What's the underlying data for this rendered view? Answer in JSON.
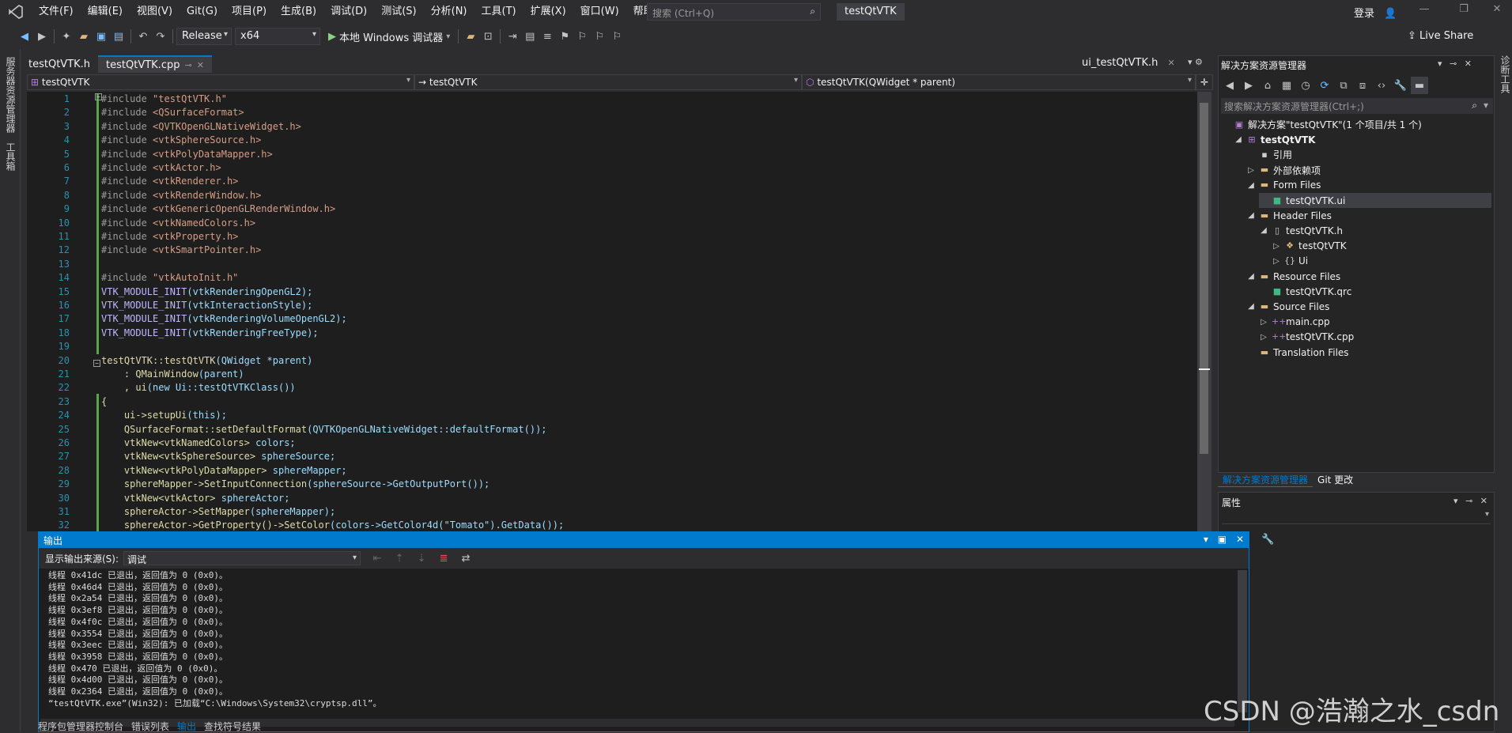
{
  "menubar": {
    "items": [
      "文件(F)",
      "编辑(E)",
      "视图(V)",
      "Git(G)",
      "项目(P)",
      "生成(B)",
      "调试(D)",
      "测试(S)",
      "分析(N)",
      "工具(T)",
      "扩展(X)",
      "窗口(W)",
      "帮助(H)"
    ],
    "search_placeholder": "搜索 (Ctrl+Q)",
    "app_name": "testQtVTK",
    "login": "登录"
  },
  "toolbar": {
    "config": "Release",
    "platform": "x64",
    "run_label": "本地 Windows 调试器",
    "live_share": "Live Share"
  },
  "left_strip": [
    "服务器资源管理器",
    "工具箱"
  ],
  "doc_tabs": [
    {
      "label": "testQtVTK.h",
      "active": false
    },
    {
      "label": "testQtVTK.cpp",
      "active": true,
      "pin": "⊸"
    }
  ],
  "doc_tab_right": "ui_testQtVTK.h",
  "navbar": {
    "project": "testQtVTK",
    "scope": "testQtVTK",
    "member": "testQtVTK(QWidget * parent)"
  },
  "editor": {
    "line_numbers": [
      "1",
      "2",
      "3",
      "4",
      "5",
      "6",
      "7",
      "8",
      "9",
      "10",
      "11",
      "12",
      "13",
      "14",
      "15",
      "16",
      "17",
      "18",
      "19",
      "20",
      "21",
      "22",
      "23",
      "24",
      "25",
      "26",
      "27",
      "28",
      "29",
      "30",
      "31",
      "32"
    ],
    "lines": [
      {
        "t": "pp",
        "s": "#include ",
        "b": "\"testQtVTK.h\""
      },
      {
        "t": "pp",
        "s": "#include ",
        "b": "<QSurfaceFormat>"
      },
      {
        "t": "pp",
        "s": "#include ",
        "b": "<QVTKOpenGLNativeWidget.h>"
      },
      {
        "t": "pp",
        "s": "#include ",
        "b": "<vtkSphereSource.h>"
      },
      {
        "t": "pp",
        "s": "#include ",
        "b": "<vtkPolyDataMapper.h>"
      },
      {
        "t": "pp",
        "s": "#include ",
        "b": "<vtkActor.h>"
      },
      {
        "t": "pp",
        "s": "#include ",
        "b": "<vtkRenderer.h>"
      },
      {
        "t": "pp",
        "s": "#include ",
        "b": "<vtkRenderWindow.h>"
      },
      {
        "t": "pp",
        "s": "#include ",
        "b": "<vtkGenericOpenGLRenderWindow.h>"
      },
      {
        "t": "pp",
        "s": "#include ",
        "b": "<vtkNamedColors.h>"
      },
      {
        "t": "pp",
        "s": "#include ",
        "b": "<vtkProperty.h>"
      },
      {
        "t": "pp",
        "s": "#include ",
        "b": "<vtkSmartPointer.h>"
      },
      {
        "t": "blank",
        "s": "",
        "b": ""
      },
      {
        "t": "pp",
        "s": "#include ",
        "b": "\"vtkAutoInit.h\""
      },
      {
        "t": "mac",
        "s": "VTK_MODULE_INIT",
        "b": "(vtkRenderingOpenGL2);"
      },
      {
        "t": "mac",
        "s": "VTK_MODULE_INIT",
        "b": "(vtkInteractionStyle);"
      },
      {
        "t": "mac",
        "s": "VTK_MODULE_INIT",
        "b": "(vtkRenderingVolumeOpenGL2);"
      },
      {
        "t": "mac",
        "s": "VTK_MODULE_INIT",
        "b": "(vtkRenderingFreeType);"
      },
      {
        "t": "blank",
        "s": "",
        "b": ""
      },
      {
        "t": "plain",
        "s": "testQtVTK::testQtVTK",
        "b": "(QWidget *parent)"
      },
      {
        "t": "plain",
        "s": "    : QMainWindow",
        "b": "(parent)"
      },
      {
        "t": "plain",
        "s": "    , ui",
        "b": "(new Ui::testQtVTKClass())"
      },
      {
        "t": "plain",
        "s": "{",
        "b": ""
      },
      {
        "t": "plain",
        "s": "    ui->setupUi",
        "b": "(this);"
      },
      {
        "t": "plain",
        "s": "    QSurfaceFormat::setDefaultFormat",
        "b": "(QVTKOpenGLNativeWidget::defaultFormat());"
      },
      {
        "t": "plain",
        "s": "    vtkNew<vtkNamedColors>",
        "b": " colors;"
      },
      {
        "t": "plain",
        "s": "    vtkNew<vtkSphereSource>",
        "b": " sphereSource;"
      },
      {
        "t": "plain",
        "s": "    vtkNew<vtkPolyDataMapper>",
        "b": " sphereMapper;"
      },
      {
        "t": "plain",
        "s": "    sphereMapper->SetInputConnection",
        "b": "(sphereSource->GetOutputPort());"
      },
      {
        "t": "plain",
        "s": "    vtkNew<vtkActor>",
        "b": " sphereActor;"
      },
      {
        "t": "plain",
        "s": "    sphereActor->SetMapper",
        "b": "(sphereMapper);"
      },
      {
        "t": "plain",
        "s": "    sphereActor->GetProperty()->SetColor",
        "b": "(colors->GetColor4d(\"Tomato\").GetData());"
      }
    ]
  },
  "solution_explorer": {
    "title": "解决方案资源管理器",
    "search_placeholder": "搜索解决方案资源管理器(Ctrl+;)",
    "items": [
      {
        "label": "解决方案\"testQtVTK\"(1 个项目/共 1 个)",
        "indent": 0,
        "arrow": "",
        "icon": "solution-icon",
        "glyph": "▣",
        "color": "#b180d7"
      },
      {
        "label": "testQtVTK",
        "indent": 1,
        "arrow": "◢",
        "icon": "project-icon",
        "glyph": "⊞",
        "color": "#b180d7",
        "bold": true
      },
      {
        "label": "引用",
        "indent": 2,
        "arrow": "",
        "icon": "references-icon",
        "glyph": "▪",
        "color": "#cccccc"
      },
      {
        "label": "外部依赖项",
        "indent": 2,
        "arrow": "▷",
        "icon": "folder-icon",
        "glyph": "▬",
        "color": "#dcb67a"
      },
      {
        "label": "Form Files",
        "indent": 2,
        "arrow": "◢",
        "icon": "folder-icon",
        "glyph": "▬",
        "color": "#dcb67a"
      },
      {
        "label": "testQtVTK.ui",
        "indent": 3,
        "arrow": "",
        "icon": "ui-file-icon",
        "glyph": "■",
        "color": "#41b883",
        "selected": true
      },
      {
        "label": "Header Files",
        "indent": 2,
        "arrow": "◢",
        "icon": "folder-icon",
        "glyph": "▬",
        "color": "#dcb67a"
      },
      {
        "label": "testQtVTK.h",
        "indent": 3,
        "arrow": "◢",
        "icon": "header-file-icon",
        "glyph": "▯",
        "color": "#cccccc"
      },
      {
        "label": "testQtVTK",
        "indent": 4,
        "arrow": "▷",
        "icon": "class-icon",
        "glyph": "❖",
        "color": "#dcb67a"
      },
      {
        "label": "Ui",
        "indent": 4,
        "arrow": "▷",
        "icon": "namespace-icon",
        "glyph": "{}",
        "color": "#cccccc"
      },
      {
        "label": "Resource Files",
        "indent": 2,
        "arrow": "◢",
        "icon": "folder-icon",
        "glyph": "▬",
        "color": "#dcb67a"
      },
      {
        "label": "testQtVTK.qrc",
        "indent": 3,
        "arrow": "",
        "icon": "qrc-file-icon",
        "glyph": "■",
        "color": "#41b883"
      },
      {
        "label": "Source Files",
        "indent": 2,
        "arrow": "◢",
        "icon": "folder-icon",
        "glyph": "▬",
        "color": "#dcb67a"
      },
      {
        "label": "main.cpp",
        "indent": 3,
        "arrow": "▷",
        "icon": "cpp-file-icon",
        "glyph": "++",
        "color": "#b180d7"
      },
      {
        "label": "testQtVTK.cpp",
        "indent": 3,
        "arrow": "▷",
        "icon": "cpp-file-icon",
        "glyph": "++",
        "color": "#b180d7"
      },
      {
        "label": "Translation Files",
        "indent": 2,
        "arrow": "",
        "icon": "folder-icon",
        "glyph": "▬",
        "color": "#dcb67a"
      }
    ],
    "tabs": [
      "解决方案资源管理器",
      "Git 更改"
    ]
  },
  "properties": {
    "title": "属性"
  },
  "output": {
    "title": "输出",
    "source_label": "显示输出来源(S):",
    "source_value": "调试",
    "lines": [
      "线程 0x41dc 已退出，返回值为 0 (0x0)。",
      "线程 0x46d4 已退出，返回值为 0 (0x0)。",
      "线程 0x2a54 已退出，返回值为 0 (0x0)。",
      "线程 0x3ef8 已退出，返回值为 0 (0x0)。",
      "线程 0x4f0c 已退出，返回值为 0 (0x0)。",
      "线程 0x3554 已退出，返回值为 0 (0x0)。",
      "线程 0x3eec 已退出，返回值为 0 (0x0)。",
      "线程 0x3958 已退出，返回值为 0 (0x0)。",
      "线程 0x470 已退出，返回值为 0 (0x0)。",
      "线程 0x4d00 已退出，返回值为 0 (0x0)。",
      "线程 0x2364 已退出，返回值为 0 (0x0)。",
      "“testQtVTK.exe”(Win32): 已加载“C:\\Windows\\System32\\cryptsp.dll”。"
    ],
    "tabs": [
      "程序包管理器控制台",
      "错误列表",
      "输出",
      "查找符号结果"
    ]
  },
  "watermark": "CSDN @浩瀚之水_csdn",
  "colors": {
    "accent": "#007acc",
    "editor_bg": "#1e1e1e",
    "chrome_bg": "#2d2d30"
  }
}
